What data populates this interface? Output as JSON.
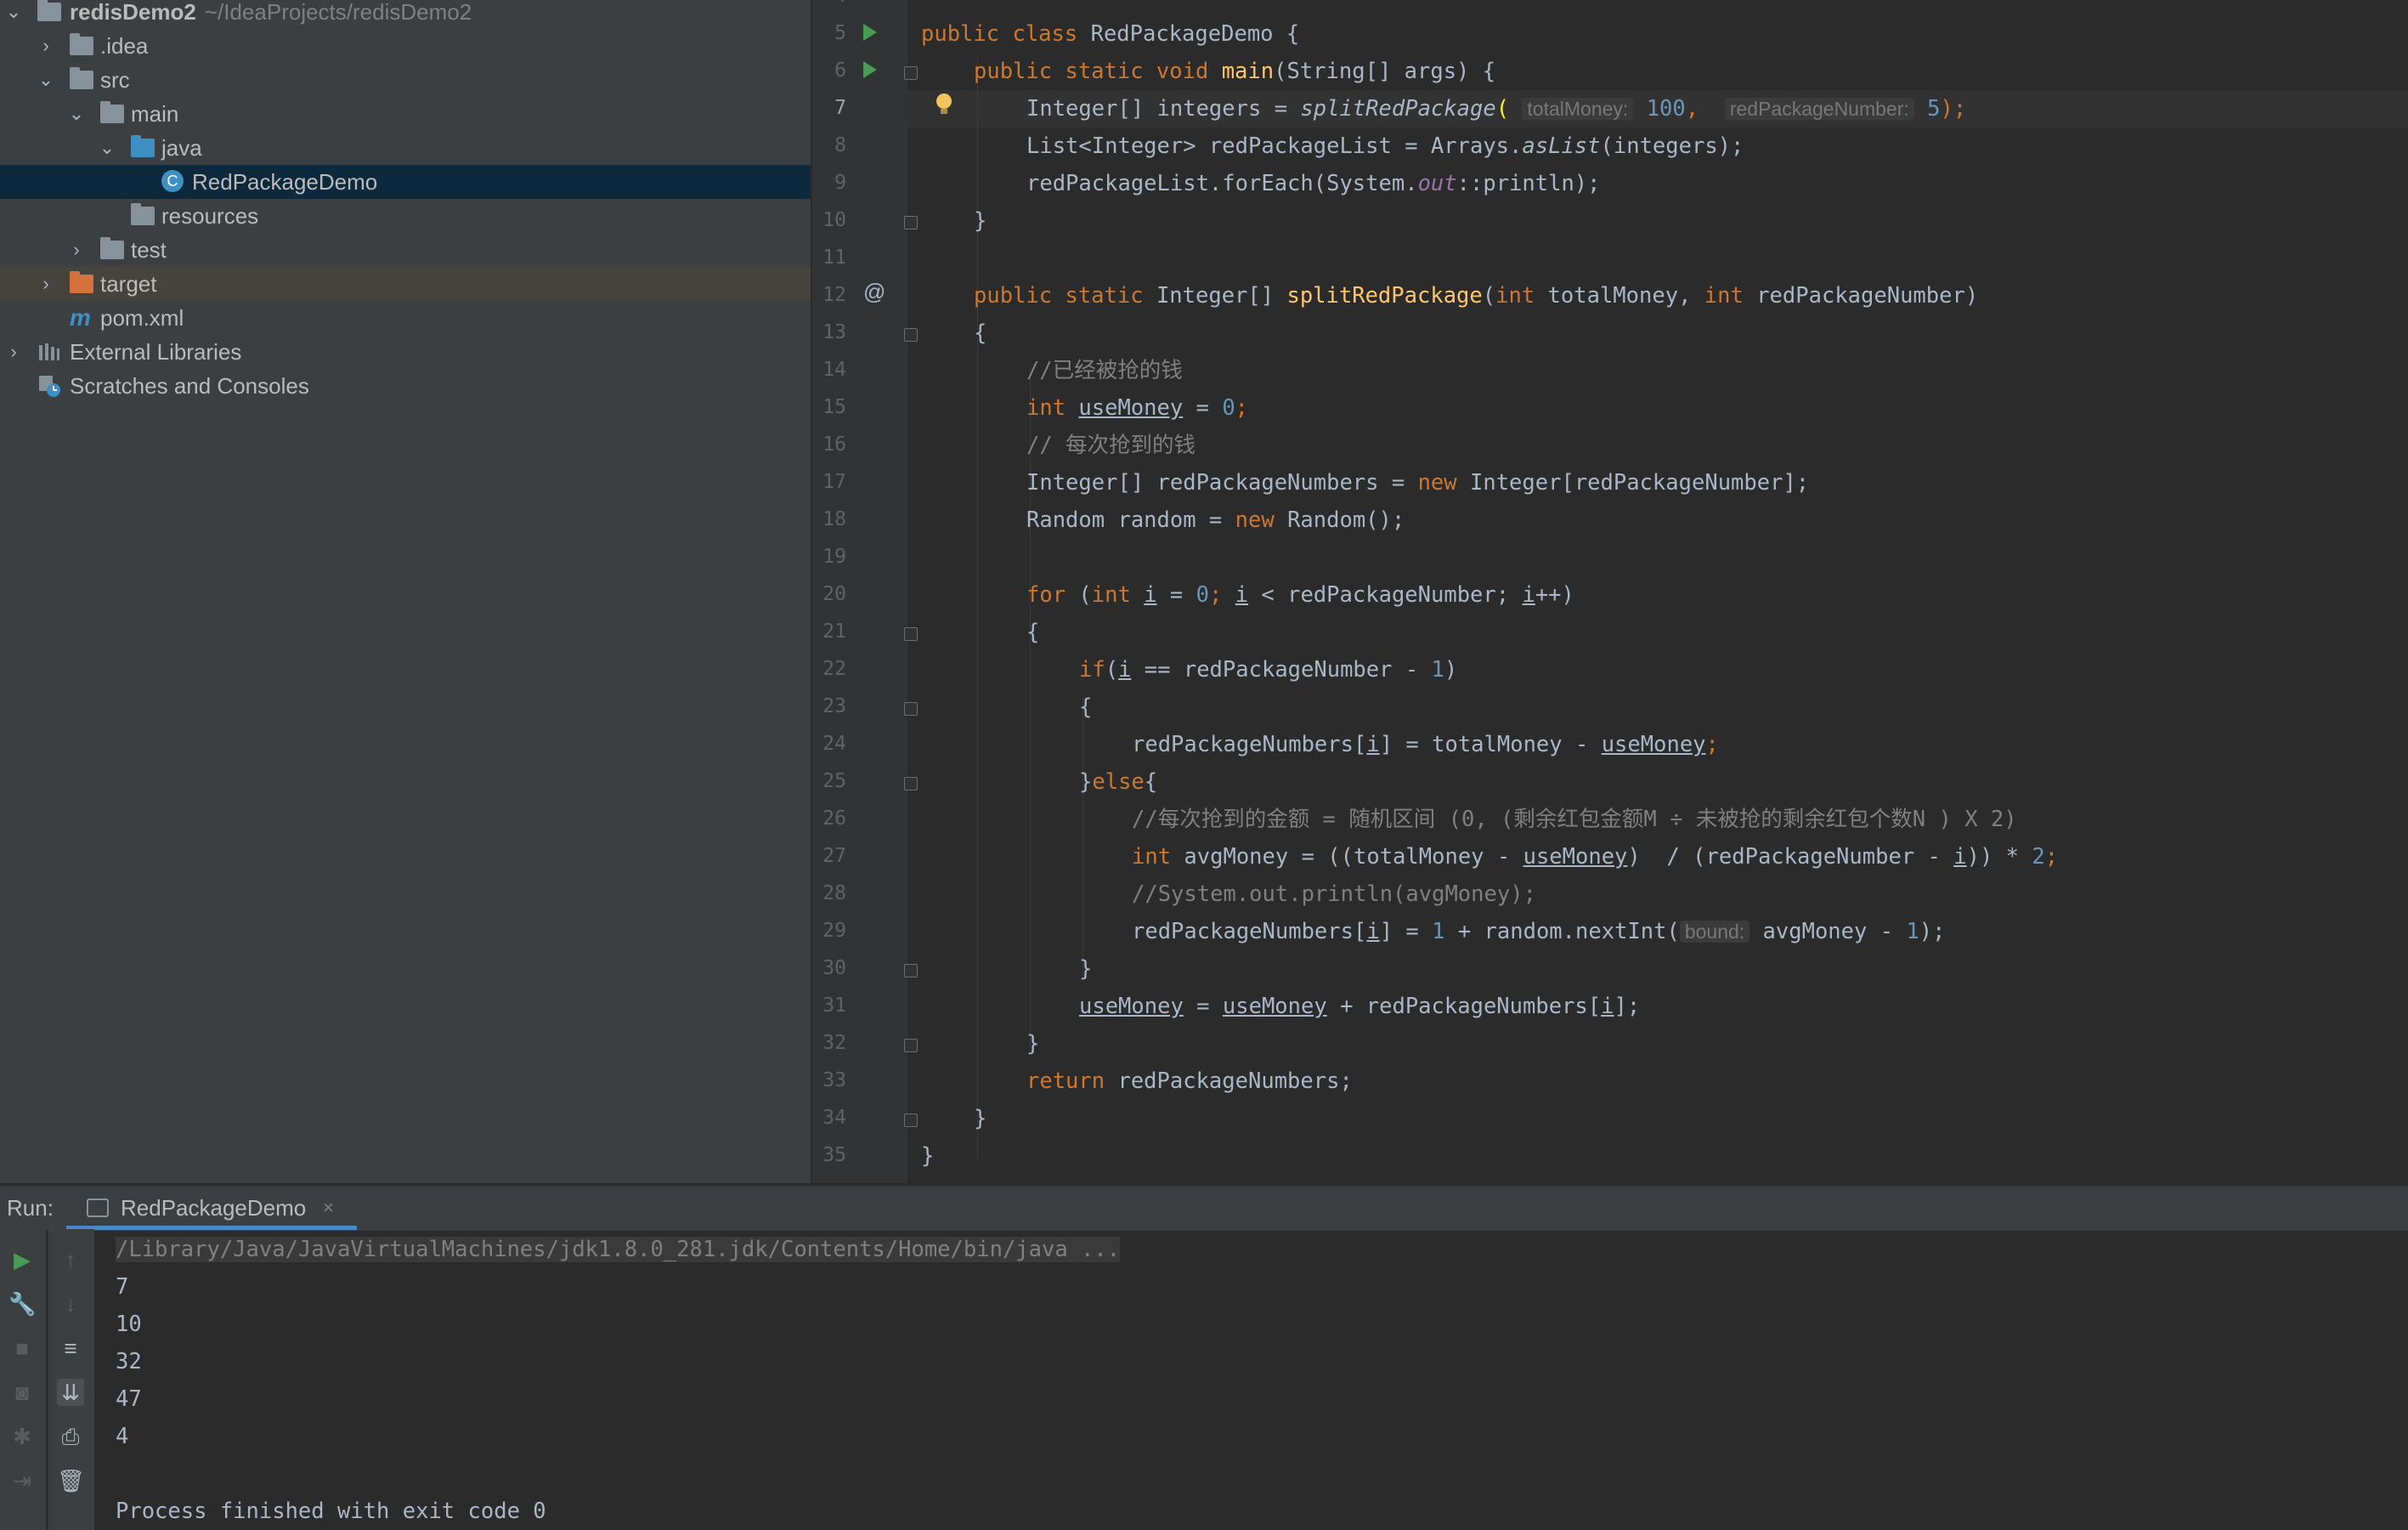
{
  "project_tree": {
    "items": [
      {
        "label": "redisDemo2",
        "sub": "~/IdeaProjects/redisDemo2",
        "icon": "module-folder-icon",
        "arrow": "expanded"
      },
      {
        "label": ".idea",
        "icon": "folder-icon",
        "arrow": "collapsed"
      },
      {
        "label": "src",
        "icon": "folder-icon",
        "arrow": "expanded"
      },
      {
        "label": "main",
        "icon": "folder-icon",
        "arrow": "expanded"
      },
      {
        "label": "java",
        "icon": "source-folder-icon",
        "arrow": "expanded"
      },
      {
        "label": "RedPackageDemo",
        "icon": "java-class-icon",
        "arrow": "none",
        "selected": true
      },
      {
        "label": "resources",
        "icon": "resources-folder-icon",
        "arrow": "none"
      },
      {
        "label": "test",
        "icon": "folder-icon",
        "arrow": "collapsed"
      },
      {
        "label": "target",
        "icon": "excluded-folder-icon",
        "arrow": "collapsed",
        "highlighted": true
      },
      {
        "label": "pom.xml",
        "icon": "maven-icon",
        "arrow": "none"
      },
      {
        "label": "External Libraries",
        "icon": "libraries-icon",
        "arrow": "collapsed"
      },
      {
        "label": "Scratches and Consoles",
        "icon": "scratches-icon",
        "arrow": "none"
      }
    ]
  },
  "editor": {
    "top_partial_line_number": "4",
    "current_line": "7",
    "line_numbers": [
      "5",
      "6",
      "7",
      "8",
      "9",
      "10",
      "11",
      "12",
      "13",
      "14",
      "15",
      "16",
      "17",
      "18",
      "19",
      "20",
      "21",
      "22",
      "23",
      "24",
      "25",
      "26",
      "27",
      "28",
      "29",
      "30",
      "31",
      "32",
      "33",
      "34",
      "35"
    ],
    "code": {
      "l5_t1": "public class ",
      "l5_t2": "RedPackageDemo {",
      "l6_t1": "public static void ",
      "l6_t2": "main",
      "l6_t3": "(String[] args) {",
      "l7_t1": "Integer[] integers = ",
      "l7_t2": "splitRedPackage",
      "l7_t3": "(",
      "l7_hint1": "totalMoney:",
      "l7_t4": "100",
      "l7_t5": ", ",
      "l7_hint2": "redPackageNumber:",
      "l7_t6": "5",
      "l7_t7": ");",
      "l8_t1": "List<Integer> redPackageList = Arrays.",
      "l8_t2": "asList",
      "l8_t3": "(integers);",
      "l9_t1": "redPackageList.forEach(System.",
      "l9_t2": "out",
      "l9_t3": "::println);",
      "l10_t1": "}",
      "l12_t1": "public static ",
      "l12_t2": "Integer[] ",
      "l12_t3": "splitRedPackage",
      "l12_t4": "(",
      "l12_t5": "int ",
      "l12_t6": "totalMoney, ",
      "l12_t7": "int ",
      "l12_t8": "redPackageNumber)",
      "l13_t1": "{",
      "l14_t1": "//已经被抢的钱",
      "l15_t1": "int ",
      "l15_t2": "useMoney",
      "l15_t3": " = ",
      "l15_t4": "0",
      "l15_t5": ";",
      "l16_t1": "// 每次抢到的钱",
      "l17_t1": "Integer[] redPackageNumbers = ",
      "l17_t2": "new ",
      "l17_t3": "Integer[redPackageNumber];",
      "l18_t1": "Random random = ",
      "l18_t2": "new ",
      "l18_t3": "Random();",
      "l20_t1": "for ",
      "l20_t2": "(",
      "l20_t3": "int ",
      "l20_t4": "i",
      "l20_t5": " = ",
      "l20_t6": "0",
      "l20_t7": "; ",
      "l20_t8": "i",
      "l20_t9": " < redPackageNumber; ",
      "l20_t10": "i",
      "l20_t11": "++)",
      "l21_t1": "{",
      "l22_t1": "if",
      "l22_t2": "(",
      "l22_t3": "i",
      "l22_t4": " == redPackageNumber - ",
      "l22_t5": "1",
      "l22_t6": ")",
      "l23_t1": "{",
      "l24_t1": "redPackageNumbers[",
      "l24_t2": "i",
      "l24_t3": "] = totalMoney - ",
      "l24_t4": "useMoney",
      "l24_t5": ";",
      "l25_t1": "}",
      "l25_t2": "else",
      "l25_t3": "{",
      "l26_t1": "//每次抢到的金额 = 随机区间 (0, (剩余红包金额M ÷ 未被抢的剩余红包个数N ) X 2)",
      "l27_t1": "int ",
      "l27_t2": "avgMoney = ((totalMoney - ",
      "l27_t3": "useMoney",
      "l27_t4": ")  / (redPackageNumber - ",
      "l27_t5": "i",
      "l27_t6": ")) * ",
      "l27_t7": "2",
      "l27_t8": ";",
      "l28_t1": "//System.out.println(avgMoney);",
      "l29_t1": "redPackageNumbers[",
      "l29_t2": "i",
      "l29_t3": "] = ",
      "l29_t4": "1",
      "l29_t5": " + random.nextInt(",
      "l29_hint": "bound:",
      "l29_t6": "avgMoney - ",
      "l29_t7": "1",
      "l29_t8": ");",
      "l30_t1": "}",
      "l31_t1": "useMoney",
      "l31_t2": " = ",
      "l31_t3": "useMoney",
      "l31_t4": " + redPackageNumbers[",
      "l31_t5": "i",
      "l31_t6": "];",
      "l32_t1": "}",
      "l33_t1": "return ",
      "l33_t2": "redPackageNumbers;",
      "l34_t1": "}",
      "l35_t1": "}"
    }
  },
  "run_panel": {
    "title": "Run:",
    "tab_label": "RedPackageDemo",
    "tab_close": "×",
    "command": "/Library/Java/JavaVirtualMachines/jdk1.8.0_281.jdk/Contents/Home/bin/java ...",
    "output": [
      "7",
      "10",
      "32",
      "47",
      "4"
    ],
    "exit_message": "Process finished with exit code 0"
  },
  "colors": {
    "keyword": "#cc7832",
    "number": "#6897bb",
    "method": "#ffc66d",
    "comment": "#808080",
    "static_field": "#9876aa",
    "default_text": "#a9b7c6",
    "selection": "#0d293e",
    "accent": "#4a88c7"
  }
}
